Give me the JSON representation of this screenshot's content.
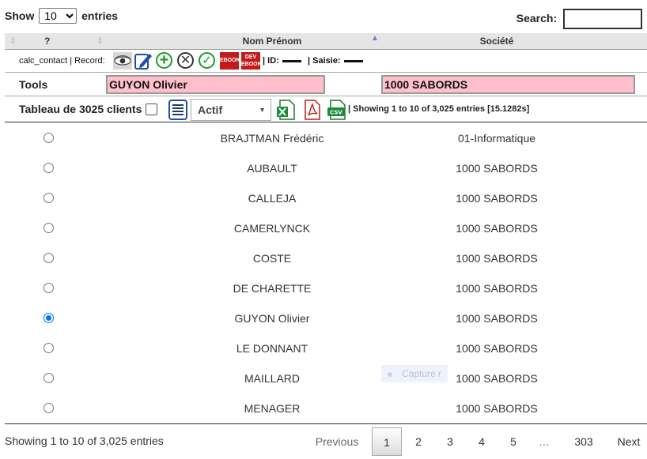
{
  "length_menu": {
    "show_label": "Show",
    "selected": "10",
    "entries_label": "entries"
  },
  "search": {
    "label": "Search:",
    "value": ""
  },
  "columns": {
    "c1": "?",
    "c2": "Nom Prénom",
    "c3": "Société"
  },
  "record_bar": {
    "label": "calc_contact | Record:",
    "ebook1": "EBOOK",
    "ebook2_top": "DEV",
    "ebook2_bottom": "EBOOK",
    "id_label": "| ID:",
    "saisie_label": "| Saisie:"
  },
  "tools": {
    "label": "Tools",
    "name_value": "GUYON Olivier",
    "societe_value": "1000 SABORDS"
  },
  "table_bar": {
    "label": "Tableau de 3025 clients",
    "status_value": "Actif",
    "info": "| Showing 1 to 10 of 3,025 entries [15.1282s]"
  },
  "rows": [
    {
      "name": "BRAJTMAN Frédéric",
      "societe": "01-Informatique",
      "selected": false
    },
    {
      "name": "AUBAULT",
      "societe": "1000 SABORDS",
      "selected": false
    },
    {
      "name": "CALLEJA",
      "societe": "1000 SABORDS",
      "selected": false
    },
    {
      "name": "CAMERLYNCK",
      "societe": "1000 SABORDS",
      "selected": false
    },
    {
      "name": "COSTE",
      "societe": "1000 SABORDS",
      "selected": false
    },
    {
      "name": "DE CHARETTE",
      "societe": "1000 SABORDS",
      "selected": false
    },
    {
      "name": "GUYON Olivier",
      "societe": "1000 SABORDS",
      "selected": true
    },
    {
      "name": "LE DONNANT",
      "societe": "1000 SABORDS",
      "selected": false
    },
    {
      "name": "MAILLARD",
      "societe": "1000 SABORDS",
      "selected": false
    },
    {
      "name": "MENAGER",
      "societe": "1000 SABORDS",
      "selected": false
    }
  ],
  "ghost_tooltip": "Capture r",
  "footer": {
    "info": "Showing 1 to 10 of 3,025 entries",
    "previous": "Previous",
    "pages": [
      "1",
      "2",
      "3",
      "4",
      "5"
    ],
    "ellipsis": "…",
    "last_page": "303",
    "next": "Next",
    "current_page": "1"
  },
  "colors": {
    "pink": "#ffc0cb",
    "accent": "#0075ff",
    "sort_active": "#6b7fd7"
  }
}
